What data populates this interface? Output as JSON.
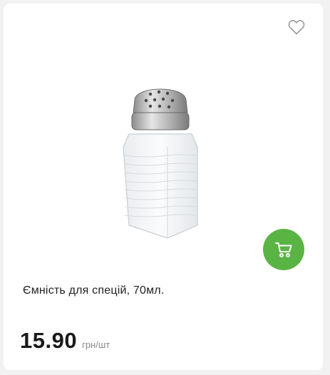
{
  "product": {
    "title": "Ємність для спецій, 70мл.",
    "price": "15.90",
    "unit": "грн/шт",
    "image_icon": "salt-shaker-image"
  },
  "actions": {
    "favorite_icon": "heart-outline-icon",
    "cart_icon": "cart-icon"
  },
  "colors": {
    "accent": "#59b443",
    "text": "#222222",
    "muted": "#8a8a8a",
    "background": "#f2f2f2",
    "card": "#ffffff"
  }
}
